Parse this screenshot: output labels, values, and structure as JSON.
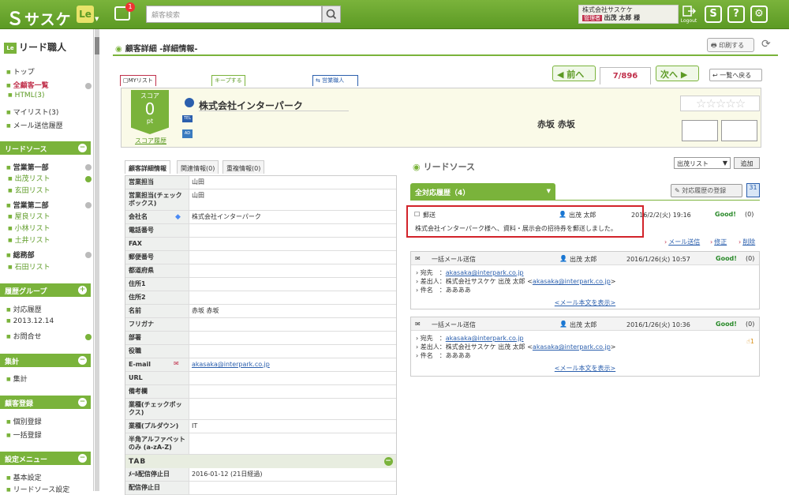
{
  "app": {
    "logo": "サスケ",
    "le_badge": "Le",
    "notify_count": "1",
    "search_placeholder": "顧客検索",
    "company": "株式会社サスケケ",
    "role": "管理者",
    "user": "出茂 太郎 様",
    "logout": "Logout",
    "accent": "#7ab33b",
    "highlight": "#d2232a"
  },
  "sidebar": {
    "title": "リード職人",
    "title_icon": "Le",
    "top": "トップ",
    "all": "全顧客一覧",
    "html": "HTML(3)",
    "mylist": "マイリスト(3)",
    "mailhist": "メール送信履歴",
    "leadsource": "リードソース",
    "dept1": "営業第一部",
    "dept1_items": [
      "出茂リスト",
      "玄田リスト"
    ],
    "dept2": "営業第二部",
    "dept2_items": [
      "屋良リスト",
      "小林リスト",
      "土井リスト"
    ],
    "dept3": "総務部",
    "dept3_items": [
      "石田リスト"
    ],
    "histgroup": "履歴グループ",
    "hist_items": [
      "対応履歴",
      "2013.12.14",
      "お問合せ"
    ],
    "totals": "集計",
    "total_items": [
      "集計"
    ],
    "custreg": "顧客登録",
    "reg_items": [
      "個別登録",
      "一括登録"
    ],
    "settings": "設定メニュー",
    "settings_items": [
      "基本設定",
      "リードソース設定"
    ]
  },
  "page": {
    "title": "顧客詳細 -詳細情報-",
    "print": "印刷する",
    "flag_tabs": [
      "□MYリスト",
      "キープする",
      "営業職人"
    ],
    "prev": "前へ",
    "count": "7/896",
    "next": "次へ",
    "back": "一覧へ戻る"
  },
  "customer": {
    "score_label": "スコア",
    "score": "0",
    "score_unit": "pt",
    "score_hist": "スコア履歴",
    "name": "株式会社インターパーク",
    "tel": "TEL",
    "fb": "AD",
    "contact": "赤坂 赤坂",
    "stars": "☆☆☆☆☆"
  },
  "detail": {
    "tabs": [
      "顧客詳細情報",
      "関連情報(0)",
      "重複情報(0)"
    ],
    "rows": [
      {
        "k": "営業担当",
        "v": "山田"
      },
      {
        "k": "営業担当(チェックボックス)",
        "v": "山田"
      },
      {
        "k": "会社名",
        "v": "株式会社インターパーク"
      },
      {
        "k": "電話番号",
        "v": ""
      },
      {
        "k": "FAX",
        "v": ""
      },
      {
        "k": "郵便番号",
        "v": ""
      },
      {
        "k": "都道府県",
        "v": ""
      },
      {
        "k": "住所1",
        "v": ""
      },
      {
        "k": "住所2",
        "v": ""
      },
      {
        "k": "名前",
        "v": "赤坂 赤坂"
      },
      {
        "k": "フリガナ",
        "v": ""
      },
      {
        "k": "部署",
        "v": ""
      },
      {
        "k": "役職",
        "v": ""
      },
      {
        "k": "E-mail",
        "v": "akasaka@interpark.co.jp",
        "link": true
      },
      {
        "k": "URL",
        "v": ""
      },
      {
        "k": "備考欄",
        "v": ""
      },
      {
        "k": "業種(チェックボックス)",
        "v": ""
      },
      {
        "k": "業種(プルダウン)",
        "v": "IT"
      },
      {
        "k": "半角アルファベットのみ (a-zA-Z)",
        "v": ""
      }
    ],
    "tab_section": "TAB",
    "rows2": [
      {
        "k": "ﾒｰﾙ配信停止日",
        "v": "2016-01-12 (21日経過)"
      },
      {
        "k": "配信停止日",
        "v": ""
      }
    ]
  },
  "leadsrc": {
    "title": "リードソース",
    "select": "出茂リスト",
    "add": "追加",
    "hist_tab": "全対応履歴（4）",
    "hist_reg": "対応履歴の登録",
    "cal": "31"
  },
  "cards": [
    {
      "type": "郵送",
      "user": "出茂 太郎",
      "date": "2016/2/2(火) 19:16",
      "good": "Good!",
      "cnt": "(0)",
      "body": "株式会社インターパーク様へ、資料・展示会の招待券を郵送しました。",
      "actions": [
        "メール送信",
        "修正",
        "削除"
      ]
    },
    {
      "type": "一括メール送信",
      "user": "出茂 太郎",
      "date": "2016/1/26(火) 10:57",
      "good": "Good!",
      "cnt": "(0)",
      "to_label": "宛先",
      "to": "akasaka@interpark.co.jp",
      "from_label": "差出人",
      "from": "株式会社サスケケ 出茂 太郎 <",
      "from_mail": "akasaka@interpark.co.jp",
      "from_end": ">",
      "subj_label": "件名",
      "subj": "ああああ",
      "more": "<メール本文を表示>"
    },
    {
      "type": "一括メール送信",
      "user": "出茂 太郎",
      "date": "2016/1/26(火) 10:36",
      "good": "Good!",
      "cnt": "(0)",
      "to_label": "宛先",
      "to": "akasaka@interpark.co.jp",
      "from_label": "差出人",
      "from": "株式会社サスケケ 出茂 太郎 <",
      "from_mail": "akasaka@interpark.co.jp",
      "from_end": ">",
      "subj_label": "件名",
      "subj": "ああああ",
      "more": "<メール本文を表示>",
      "click": "1"
    }
  ]
}
